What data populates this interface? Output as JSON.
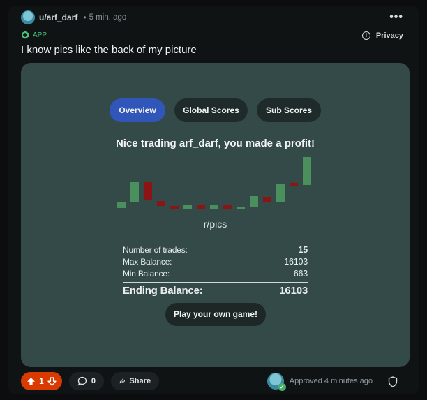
{
  "post": {
    "username": "u/arf_darf",
    "separator": "•",
    "time": "5 min. ago",
    "app_label": "APP",
    "privacy_label": "Privacy",
    "title": "I know pics like the back of my picture"
  },
  "game": {
    "tabs": [
      {
        "label": "Overview",
        "active": true
      },
      {
        "label": "Global Scores",
        "active": false
      },
      {
        "label": "Sub Scores",
        "active": false
      }
    ],
    "message": "Nice trading arf_darf, you made a profit!",
    "subreddit": "r/pics",
    "stats": [
      {
        "label": "Number of trades:",
        "value": "15"
      },
      {
        "label": "Max Balance:",
        "value": "16103"
      },
      {
        "label": "Min Balance:",
        "value": "663"
      }
    ],
    "final": {
      "label": "Ending Balance:",
      "value": "16103"
    },
    "play_label": "Play your own game!",
    "colors": {
      "up": "#4a8f5c",
      "down": "#8b1414"
    }
  },
  "footer": {
    "vote_count": "1",
    "comment_count": "0",
    "share_label": "Share",
    "approved_text": "Approved 4 minutes ago"
  },
  "icons": [
    "more-icon",
    "app-icon",
    "info-icon",
    "upvote-icon",
    "downvote-icon",
    "comment-icon",
    "share-icon",
    "shield-icon",
    "check-icon"
  ]
}
